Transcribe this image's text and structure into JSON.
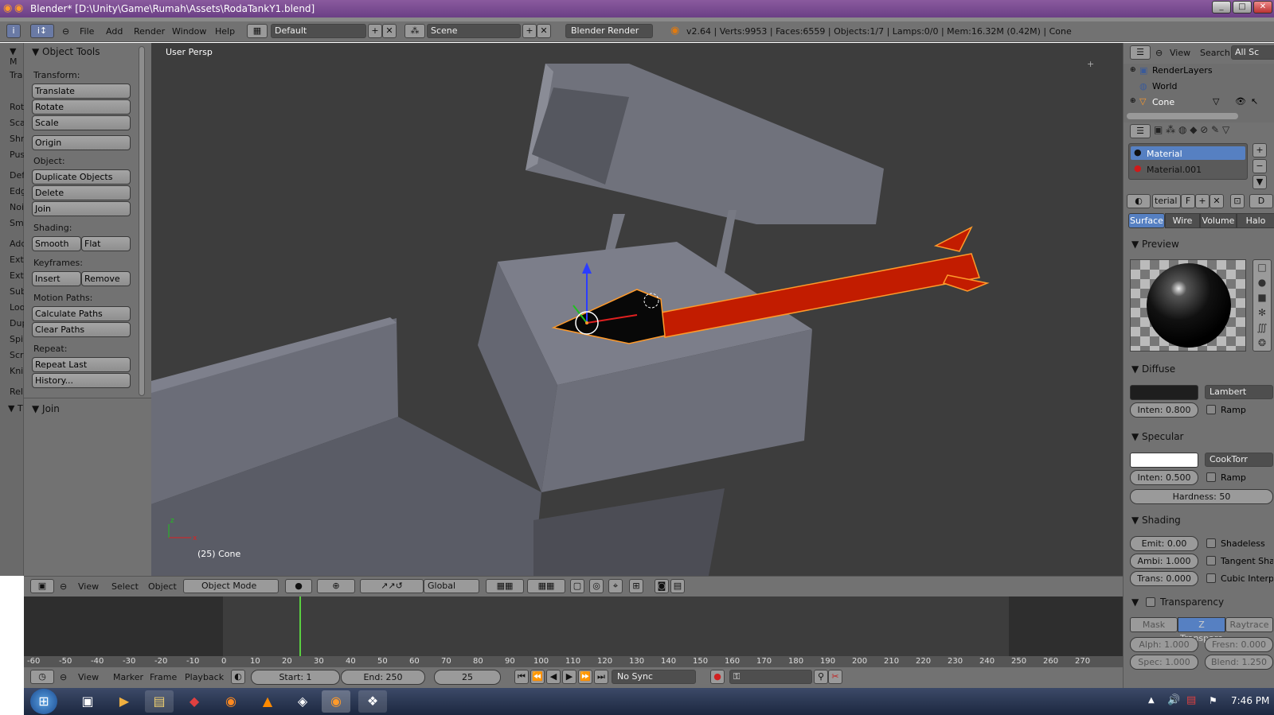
{
  "window": {
    "title": "Blender* [D:\\Unity\\Game\\Rumah\\Assets\\RodaTankY1.blend]"
  },
  "menu": [
    "File",
    "Add",
    "Render",
    "Window",
    "Help"
  ],
  "topbar": {
    "layout": "Default",
    "scene": "Scene",
    "engine": "Blender Render",
    "stats": "v2.64 | Verts:9953 | Faces:6559 | Objects:1/7 | Lamps:0/0 | Mem:16.32M (0.42M) | Cone"
  },
  "tabs": [
    "Tra",
    "Rot",
    "Sca",
    "Shr",
    "Pus",
    "Def",
    "Edg",
    "Noi",
    "Sm",
    "Add",
    "Ext",
    "Ext",
    "Sub",
    "Loo",
    "Dup",
    "Spi",
    "Scr",
    "Kni",
    "Rel"
  ],
  "tools": {
    "header": "Object Tools",
    "transform_label": "Transform:",
    "translate": "Translate",
    "rotate": "Rotate",
    "scale": "Scale",
    "origin": "Origin",
    "object_label": "Object:",
    "duplicate": "Duplicate Objects",
    "delete": "Delete",
    "join": "Join",
    "shading_label": "Shading:",
    "smooth": "Smooth",
    "flat": "Flat",
    "keyframes_label": "Keyframes:",
    "insert": "Insert",
    "remove": "Remove",
    "motion_label": "Motion Paths:",
    "calc_paths": "Calculate Paths",
    "clear_paths": "Clear Paths",
    "repeat_label": "Repeat:",
    "repeat_last": "Repeat Last",
    "history": "History...",
    "join_panel": "Join"
  },
  "viewport": {
    "persp": "User Persp",
    "object": "(25) Cone",
    "colors": {
      "rocket": "#c21c00",
      "outline": "#ff9a2a",
      "bg": "#3d3d3d",
      "mesh": "#747783"
    }
  },
  "vpbar": {
    "view": "View",
    "select": "Select",
    "object": "Object",
    "mode": "Object Mode",
    "orient": "Global"
  },
  "ruler": [
    "-60",
    "-50",
    "-40",
    "-30",
    "-20",
    "-10",
    "0",
    "10",
    "20",
    "30",
    "40",
    "50",
    "60",
    "70",
    "80",
    "90",
    "100",
    "110",
    "120",
    "130",
    "140",
    "150",
    "160",
    "170",
    "180",
    "190",
    "200",
    "210",
    "220",
    "230",
    "240",
    "250",
    "260",
    "270"
  ],
  "tlbar": {
    "view": "View",
    "marker": "Marker",
    "frame": "Frame",
    "playback": "Playback",
    "start": "Start: 1",
    "end": "End: 250",
    "current": "25",
    "sync": "No Sync"
  },
  "outliner": {
    "view": "View",
    "search": "Search",
    "filter": "All Sc",
    "items": [
      "RenderLayers",
      "World",
      "Cone"
    ]
  },
  "props": {
    "materials": [
      "Material",
      "Material.001"
    ],
    "matfield": "terial",
    "f": "F",
    "d": "D",
    "tabs": [
      "Surface",
      "Wire",
      "Volume",
      "Halo"
    ],
    "preview": "Preview",
    "diffuse": "Diffuse",
    "diffuse_shader": "Lambert",
    "diffuse_inten": "Inten: 0.800",
    "ramp": "Ramp",
    "specular": "Specular",
    "spec_shader": "CookTorr",
    "spec_inten": "Inten: 0.500",
    "ramp2": "Ramp",
    "hardness": "Hardness: 50",
    "shading": "Shading",
    "emit": "Emit: 0.00",
    "shadeless": "Shadeless",
    "ambi": "Ambi: 1.000",
    "tangent": "Tangent Shac",
    "trans": "Trans: 0.000",
    "cubic": "Cubic Interp",
    "transparency": "Transparency",
    "mask": "Mask",
    "ztransp": "Z Transpare",
    "raytrace": "Raytrace",
    "alpha": "Alph: 1.000",
    "fresnel": "Fresn: 0.000",
    "spec2": "Spec: 1.000",
    "blend": "Blend: 1.250"
  },
  "taskbar": {
    "clock": "7:46 PM"
  }
}
